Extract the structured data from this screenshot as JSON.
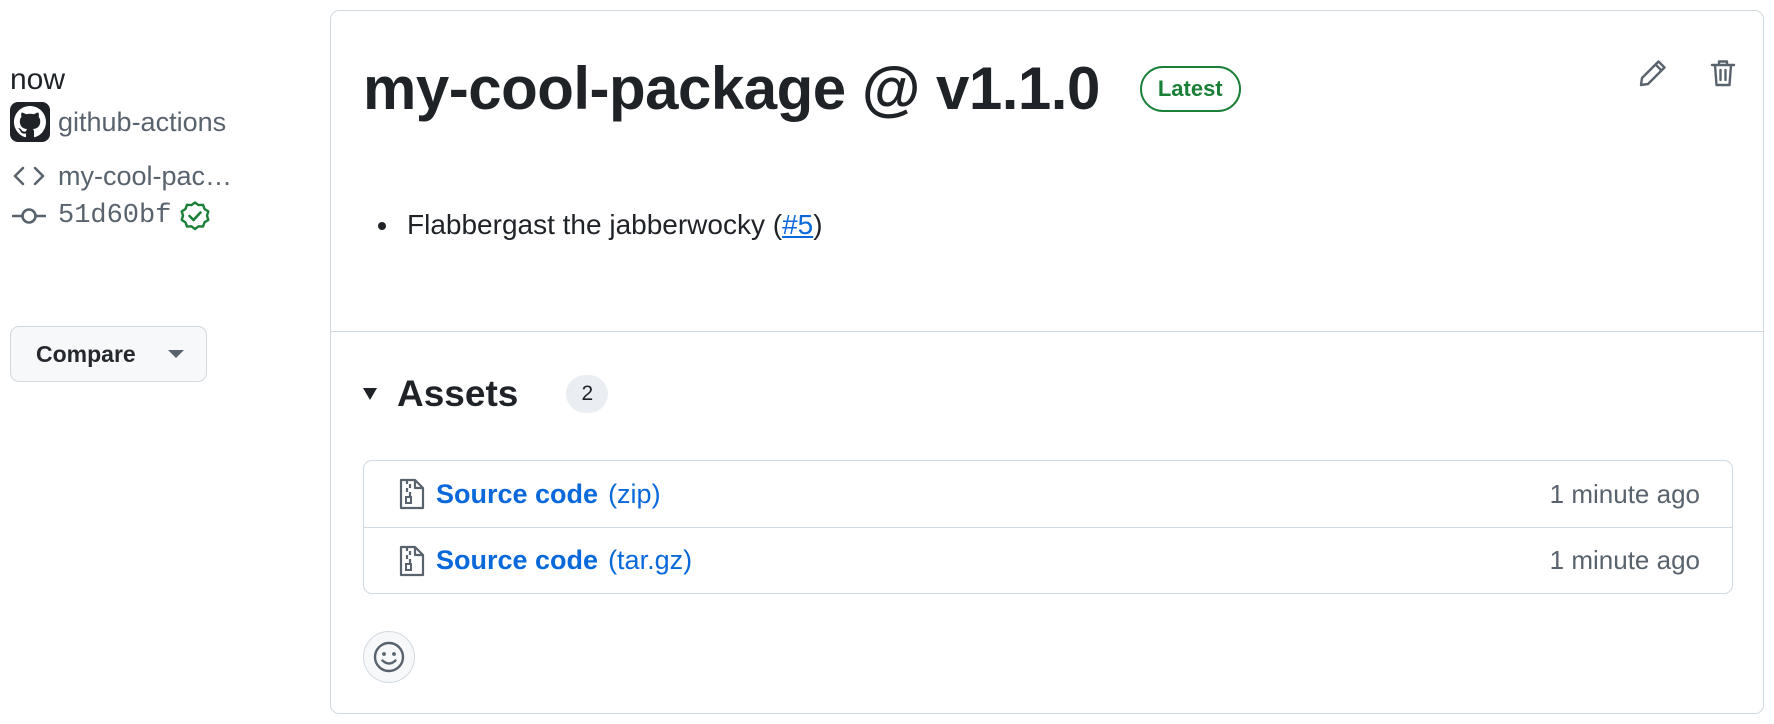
{
  "sidebar": {
    "time": "now",
    "author": "github-actions",
    "tag": "my-cool-pac…",
    "commit": "51d60bf",
    "compare_label": "Compare",
    "icons": {
      "avatar": "github-mark-icon",
      "tag": "code-icon",
      "commit": "git-commit-icon",
      "verified": "verified-check-icon",
      "dropdown": "chevron-down-icon"
    }
  },
  "release": {
    "title": "my-cool-package @ v1.1.0",
    "badge": "Latest",
    "notes": [
      {
        "text": "Flabbergast the jabberwocky (",
        "link": "#5",
        "suffix": ")"
      }
    ],
    "actions": [
      {
        "icon": "pencil-icon"
      },
      {
        "icon": "trash-icon"
      }
    ]
  },
  "assets": {
    "title": "Assets",
    "count": "2",
    "items": [
      {
        "name": "Source code",
        "ext": "(zip)",
        "time": "1 minute ago",
        "icon": "file-zip-icon"
      },
      {
        "name": "Source code",
        "ext": "(tar.gz)",
        "time": "1 minute ago",
        "icon": "file-zip-icon"
      }
    ]
  },
  "reaction": {
    "icon": "smiley-icon"
  },
  "colors": {
    "link": "#0969da",
    "success": "#1a7f37",
    "border": "#d1d9e0",
    "muted": "#59636e",
    "text": "#1f2328"
  }
}
